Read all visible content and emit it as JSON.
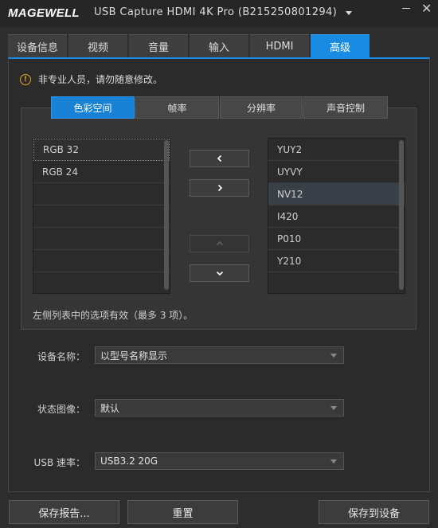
{
  "app": {
    "logo": "MAGEWELL",
    "title": "USB Capture HDMI 4K Pro (B215250801294)"
  },
  "tabs": [
    {
      "label": "设备信息",
      "active": false
    },
    {
      "label": "视频",
      "active": false
    },
    {
      "label": "音量",
      "active": false
    },
    {
      "label": "输入",
      "active": false
    },
    {
      "label": "HDMI",
      "active": false
    },
    {
      "label": "高级",
      "active": true
    }
  ],
  "warning": "非专业人员，请勿随意修改。",
  "subtabs": [
    {
      "label": "色彩空间",
      "active": true
    },
    {
      "label": "帧率",
      "active": false
    },
    {
      "label": "分辨率",
      "active": false
    },
    {
      "label": "声音控制",
      "active": false
    }
  ],
  "left_list": [
    "RGB 32",
    "RGB 24",
    "",
    "",
    "",
    "",
    ""
  ],
  "right_list": [
    "YUY2",
    "UYVY",
    "NV12",
    "I420",
    "P010",
    "Y210",
    ""
  ],
  "note": "左侧列表中的选项有效（最多 3 项）。",
  "fields": {
    "device_name": {
      "label": "设备名称：",
      "value": "以型号名称显示"
    },
    "status_image": {
      "label": "状态图像：",
      "value": "默认"
    },
    "usb_speed": {
      "label": "USB 速率：",
      "value": "USB3.2 20G"
    }
  },
  "buttons": {
    "save_report": "保存报告...",
    "reset": "重置",
    "save_to_device": "保存到设备"
  },
  "colors": {
    "accent": "#1a8be3",
    "warning": "#e8a020"
  }
}
